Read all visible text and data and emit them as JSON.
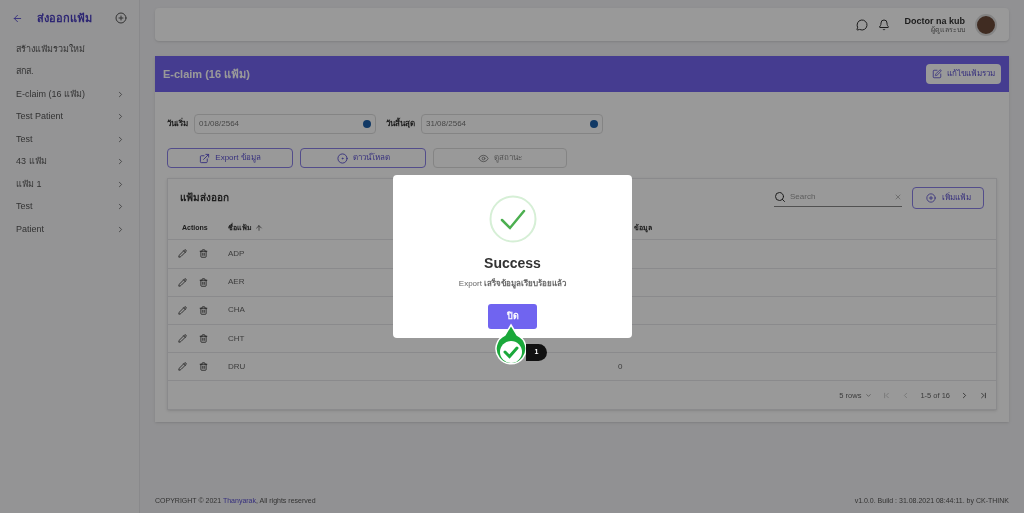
{
  "sidebar": {
    "title": "ส่งออกแฟ้ม",
    "items": [
      {
        "label": "สร้างแฟ้มรวมใหม่",
        "expandable": false
      },
      {
        "label": "สกส.",
        "expandable": false
      },
      {
        "label": "E-claim (16 แฟ้ม)",
        "expandable": true
      },
      {
        "label": "Test Patient",
        "expandable": true
      },
      {
        "label": "Test",
        "expandable": true
      },
      {
        "label": "43 แฟ้ม",
        "expandable": true
      },
      {
        "label": "แฟ้ม 1",
        "expandable": true
      },
      {
        "label": "Test",
        "expandable": true
      },
      {
        "label": "Patient",
        "expandable": true
      }
    ]
  },
  "header": {
    "user_name": "Doctor na kub",
    "user_role": "ผู้ดูแลระบบ"
  },
  "panel": {
    "title": "E-claim (16 แฟ้ม)",
    "edit_button": "แก้ไขแฟ้มรวม",
    "date_fields": [
      {
        "label": "วันเริ่ม",
        "value": "01/08/2564"
      },
      {
        "label": "วันสิ้นสุด",
        "value": "31/08/2564"
      }
    ],
    "buttons": [
      {
        "kind": "export",
        "label": "Export ข้อมูล",
        "disabled": false
      },
      {
        "kind": "download",
        "label": "ดาวน์โหลด",
        "disabled": false
      },
      {
        "kind": "status",
        "label": "ดูสถานะ",
        "disabled": true
      }
    ]
  },
  "table": {
    "title": "แฟ้มส่งออก",
    "search": {
      "placeholder": "Search"
    },
    "add_button": "เพิ่มแฟ้ม",
    "columns": [
      "Actions",
      "ชื่อแฟ้ม",
      "ข้อมูล"
    ],
    "rows": [
      {
        "name": "ADP"
      },
      {
        "name": "AER"
      },
      {
        "name": "CHA"
      },
      {
        "name": "CHT"
      },
      {
        "name": "DRU",
        "count": "0"
      }
    ],
    "pagination": {
      "rows_per_page": "5 rows",
      "range": "1-5 of 16"
    }
  },
  "footer": {
    "copyright": "COPYRIGHT © 2021",
    "link": "Thanyarak",
    "rights": ", All rights reserved",
    "version": "v1.0.0. Build : 31.08.2021 08:44:11. by CK-THINK"
  },
  "dialog": {
    "title": "Success",
    "message": "Export **เสร็จข้อมูลเรียบร้อยแล้ว**",
    "button": "ปิด"
  },
  "click_marker": {
    "label": "1"
  }
}
